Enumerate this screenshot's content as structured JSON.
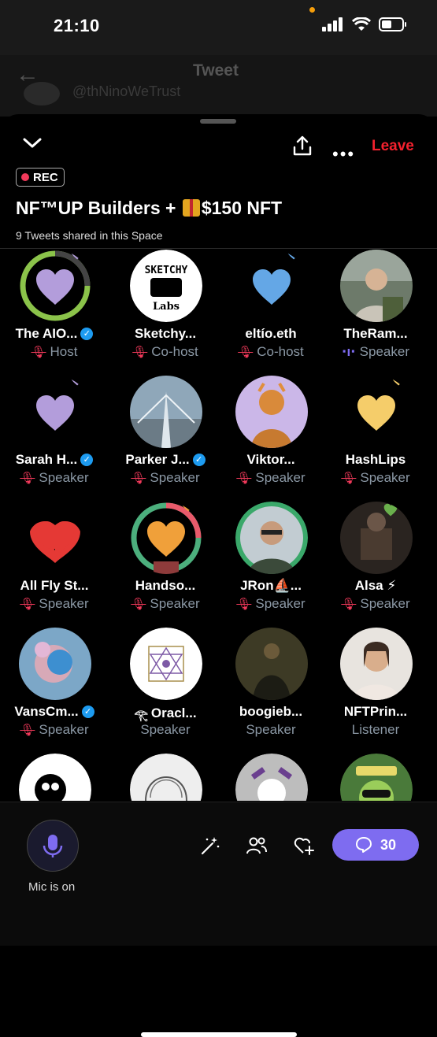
{
  "status": {
    "time": "21:10"
  },
  "background": {
    "title": "Tweet",
    "handle": "@thNinoWeTrust"
  },
  "header": {
    "leave_label": "Leave",
    "rec_label": "REC"
  },
  "space": {
    "title_part1": "NF™UP Builders + ",
    "title_part2": "$150 NFT",
    "subtitle": "9 Tweets shared in this Space"
  },
  "participants": [
    {
      "name": "The AIO...",
      "role": "Host",
      "verified": true,
      "muted": true,
      "avatar": "heart-lilac-ring"
    },
    {
      "name": "Sketchy...",
      "role": "Co-host",
      "verified": false,
      "muted": true,
      "avatar": "sketchy-labs-logo"
    },
    {
      "name": "eltío.eth",
      "role": "Co-host",
      "verified": false,
      "muted": true,
      "avatar": "heart-blue"
    },
    {
      "name": "TheRam...",
      "role": "Speaker",
      "verified": false,
      "muted": false,
      "speaking": true,
      "avatar": "photo-man"
    },
    {
      "name": "Sarah H...",
      "role": "Speaker",
      "verified": true,
      "muted": true,
      "avatar": "heart-lilac"
    },
    {
      "name": "Parker J...",
      "role": "Speaker",
      "verified": true,
      "muted": true,
      "avatar": "photo-bridge"
    },
    {
      "name": "Viktor...",
      "role": "Speaker",
      "verified": false,
      "muted": true,
      "avatar": "art-orange-figure"
    },
    {
      "name": "HashLips",
      "role": "Speaker",
      "verified": false,
      "muted": true,
      "avatar": "heart-yellow"
    },
    {
      "name": "All Fly St...",
      "role": "Speaker",
      "verified": false,
      "muted": true,
      "avatar": "heart-red"
    },
    {
      "name": "Handso...",
      "role": "Speaker",
      "verified": false,
      "muted": true,
      "avatar": "heart-orange-ring"
    },
    {
      "name": "JRon⛵...",
      "role": "Speaker",
      "verified": false,
      "muted": true,
      "avatar": "photo-glasses"
    },
    {
      "name": "Alsa ⚡",
      "role": "Speaker",
      "verified": false,
      "muted": true,
      "avatar": "art-dark"
    },
    {
      "name": "VansCm...",
      "role": "Speaker",
      "verified": true,
      "muted": true,
      "avatar": "art-blue-face"
    },
    {
      "name": "Oracl...",
      "role": "Speaker",
      "verified": false,
      "muted": false,
      "prefix": "𓂀",
      "avatar": "yantra"
    },
    {
      "name": "boogieb...",
      "role": "Speaker",
      "verified": false,
      "muted": false,
      "avatar": "painting"
    },
    {
      "name": "NFTPrin...",
      "role": "Listener",
      "verified": false,
      "muted": false,
      "avatar": "photo-woman"
    },
    {
      "name": "",
      "role": "",
      "avatar": "bw-skull"
    },
    {
      "name": "",
      "role": "",
      "avatar": "sketch-portrait"
    },
    {
      "name": "",
      "role": "",
      "avatar": "skull-purple"
    },
    {
      "name": "",
      "role": "",
      "avatar": "frog-hat"
    }
  ],
  "bottom": {
    "mic_label": "Mic is on",
    "comment_count": "30"
  },
  "colors": {
    "accent": "#7e6cf0",
    "leave": "#f4212e",
    "muted": "#f0395a",
    "secondary": "#8b98a5"
  }
}
